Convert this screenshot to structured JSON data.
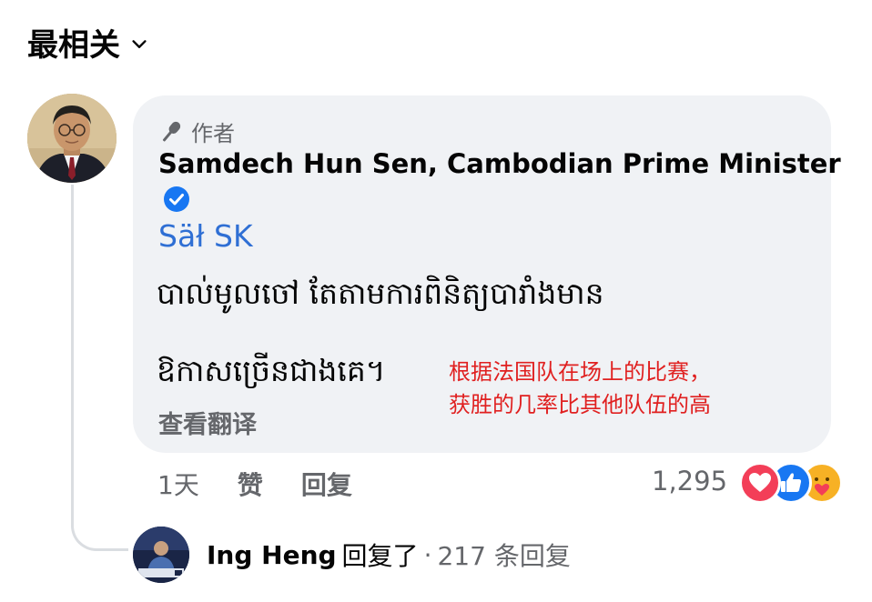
{
  "header": {
    "sort_label": "最相关",
    "sort_icon": "chevron-down-icon"
  },
  "comment": {
    "author_badge": "作者",
    "author_badge_icon": "microphone-icon",
    "author_name": "Samdech Hun Sen, Cambodian Prime Minister",
    "verified_icon": "verified-badge-icon",
    "verified_color": "#1877f2",
    "mention": "Säł SK",
    "mention_color": "#2f6fd4",
    "text_line1": "បាល់មូលចៅ តែតាមការពិនិត្យបារាំងមាន",
    "text_line2": "ឱកាសច្រើនជាងគេ។",
    "see_translation": "查看翻译",
    "annotation_line1": "根据法国队在场上的比赛，",
    "annotation_line2": "获胜的几率比其他队伍的高",
    "annotation_color": "#e02020"
  },
  "actions": {
    "time": "1天",
    "like": "赞",
    "reply": "回复",
    "reaction_count": "1,295",
    "reaction_icons": [
      "love-reaction-icon",
      "like-reaction-icon",
      "care-reaction-icon"
    ]
  },
  "reply_summary": {
    "replier": "Ing Heng",
    "replied_text": "回复了",
    "separator": "·",
    "count_text": "217 条回复"
  }
}
